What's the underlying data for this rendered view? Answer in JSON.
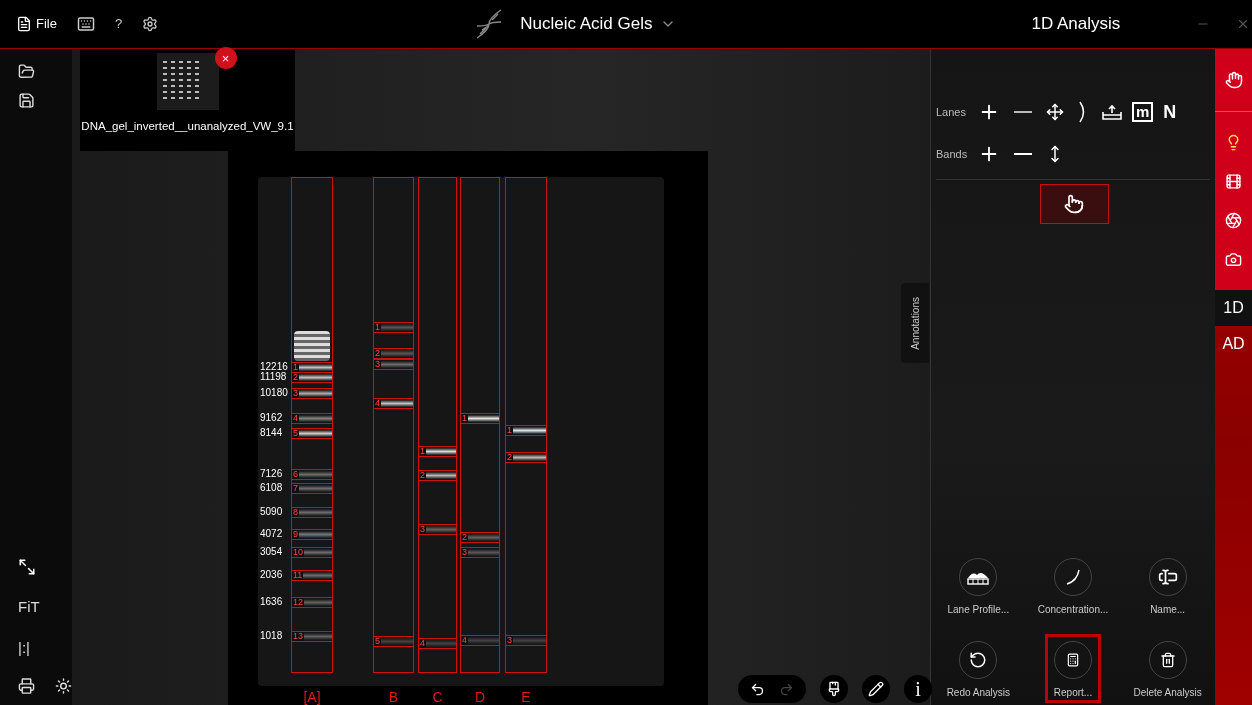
{
  "top_bar": {
    "file_label": "File",
    "help_label": "?",
    "app_title": "Nucleic Acid Gels",
    "panel_title": "1D Analysis"
  },
  "left_toolbar": {
    "fit_label": "FiT",
    "actual_size_label": "|:|"
  },
  "thumbnail": {
    "filename": "DNA_gel_inverted__unanalyzed_VW_9.1",
    "close_label": "×"
  },
  "gel": {
    "lanes": [
      {
        "label": "[A]",
        "bands": [
          {
            "number": "1",
            "marker": "12216"
          },
          {
            "number": "2",
            "marker": "11198"
          },
          {
            "number": "3",
            "marker": "10180"
          },
          {
            "number": "4",
            "marker": "9162"
          },
          {
            "number": "5",
            "marker": "8144"
          },
          {
            "number": "6",
            "marker": "7126"
          },
          {
            "number": "7",
            "marker": "6108"
          },
          {
            "number": "8",
            "marker": "5090"
          },
          {
            "number": "9",
            "marker": "4072"
          },
          {
            "number": "10",
            "marker": "3054"
          },
          {
            "number": "11",
            "marker": "2036"
          },
          {
            "number": "12",
            "marker": "1636"
          },
          {
            "number": "13",
            "marker": "1018"
          }
        ]
      },
      {
        "label": "B",
        "bands": [
          {
            "number": "1"
          },
          {
            "number": "2"
          },
          {
            "number": "3"
          },
          {
            "number": "4"
          },
          {
            "number": "5"
          }
        ]
      },
      {
        "label": "C",
        "bands": [
          {
            "number": "1"
          },
          {
            "number": "2"
          },
          {
            "number": "3"
          },
          {
            "number": "4"
          }
        ]
      },
      {
        "label": "D",
        "bands": [
          {
            "number": "1"
          },
          {
            "number": "2"
          },
          {
            "number": "3"
          },
          {
            "number": "4"
          }
        ]
      },
      {
        "label": "E",
        "bands": [
          {
            "number": "1"
          },
          {
            "number": "2"
          },
          {
            "number": "3"
          }
        ]
      }
    ]
  },
  "annotations_tab": "Annotations",
  "canvas_toolbar": {
    "redo_disabled": true,
    "info_label": "i"
  },
  "analysis_panel": {
    "lanes_label": "Lanes",
    "lane_tools": [
      {
        "kind": "add"
      },
      {
        "kind": "remove"
      },
      {
        "kind": "move"
      },
      {
        "kind": "curve"
      },
      {
        "kind": "upload"
      },
      {
        "kind": "boxed",
        "label": "m"
      },
      {
        "kind": "letter",
        "label": "N"
      }
    ],
    "bands_label": "Bands",
    "band_tools": [
      {
        "kind": "add"
      },
      {
        "kind": "remove"
      },
      {
        "kind": "move"
      }
    ],
    "select_tool": {
      "selected": true
    },
    "actions": [
      {
        "kind": "profile",
        "label": "Lane Profile...",
        "highlighted": false
      },
      {
        "kind": "curve",
        "label": "Concentration...",
        "highlighted": false
      },
      {
        "kind": "name",
        "label": "Name...",
        "highlighted": false
      },
      {
        "kind": "redo",
        "label": "Redo Analysis",
        "highlighted": false
      },
      {
        "kind": "report",
        "label": "Report...",
        "highlighted": true
      },
      {
        "kind": "delete",
        "label": "Delete Analysis",
        "highlighted": false
      }
    ]
  },
  "right_rail": {
    "tabs": [
      {
        "label": "1D",
        "selected": true
      },
      {
        "label": "AD",
        "selected": false
      }
    ]
  }
}
